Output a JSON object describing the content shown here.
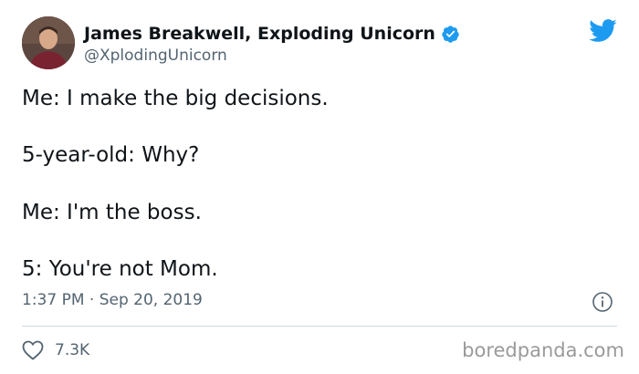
{
  "author": {
    "display_name": "James Breakwell, Exploding Unicorn",
    "handle": "@XplodingUnicorn",
    "verified": true,
    "avatar_icon": "avatar-photo"
  },
  "platform_icon": "twitter-bird-icon",
  "colors": {
    "accent": "#1d9bf0",
    "text": "#0f1419",
    "secondary": "#536471",
    "divider": "#cfd9de",
    "watermark": "#9a9a9a"
  },
  "tweet": {
    "lines": [
      "Me: I make the big decisions.",
      "5-year-old: Why?",
      "Me: I'm the boss.",
      "5: You're not Mom."
    ],
    "timestamp": "1:37 PM · Sep 20, 2019"
  },
  "actions": {
    "like_count": "7.3K",
    "like_icon": "heart-icon",
    "info_icon": "info-icon"
  },
  "watermark": "boredpanda.com"
}
